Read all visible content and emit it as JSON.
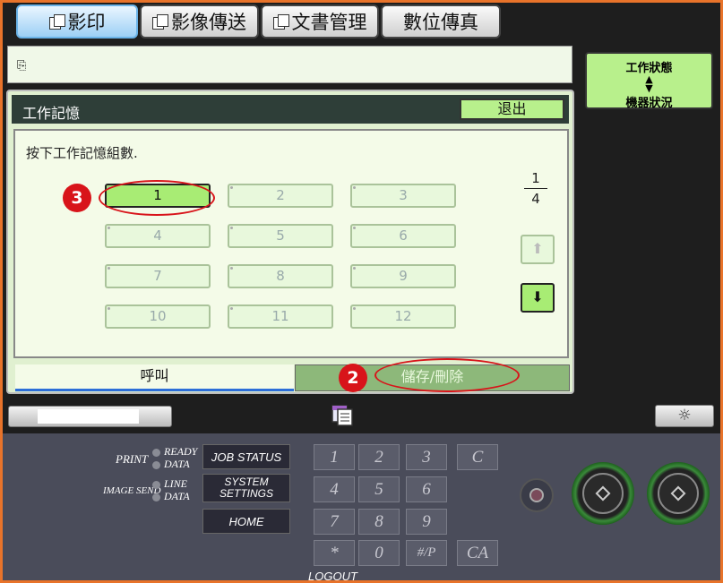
{
  "tabs": [
    {
      "label": "影印",
      "active": true
    },
    {
      "label": "影像傳送",
      "active": false
    },
    {
      "label": "文書管理",
      "active": false
    },
    {
      "label": "數位傳真",
      "active": false
    }
  ],
  "side_button": {
    "line1": "工作狀態",
    "line2": "機器狀況"
  },
  "panel": {
    "title": "工作記憶",
    "exit_label": "退出",
    "prompt": "按下工作記憶組數.",
    "buttons": [
      "1",
      "2",
      "3",
      "4",
      "5",
      "6",
      "7",
      "8",
      "9",
      "10",
      "11",
      "12"
    ],
    "selected": "1",
    "page_current": "1",
    "page_total": "4",
    "tab_recall": "呼叫",
    "tab_store": "儲存/刪除"
  },
  "markers": {
    "step2": "2",
    "step3": "3"
  },
  "console": {
    "print": "PRINT",
    "ready": "READY",
    "data": "DATA",
    "image_send": "IMAGE SEND",
    "line": "LINE",
    "data2": "DATA",
    "job_status": "JOB STATUS",
    "system_settings_1": "SYSTEM",
    "system_settings_2": "SETTINGS",
    "home": "HOME",
    "keys": [
      "1",
      "2",
      "3",
      "C",
      "4",
      "5",
      "6",
      "7",
      "8",
      "9",
      "*",
      "0",
      "#/P",
      "CA"
    ],
    "logout": "LOGOUT"
  },
  "colors": {
    "accent_green": "#b8f08c",
    "marker_red": "#d8141a",
    "active_tab": "#9ccff5"
  },
  "icons": {
    "stop": "stop-icon",
    "start_bw": "start-bw-icon",
    "start_color": "start-color-icon",
    "brightness": "brightness-icon"
  }
}
